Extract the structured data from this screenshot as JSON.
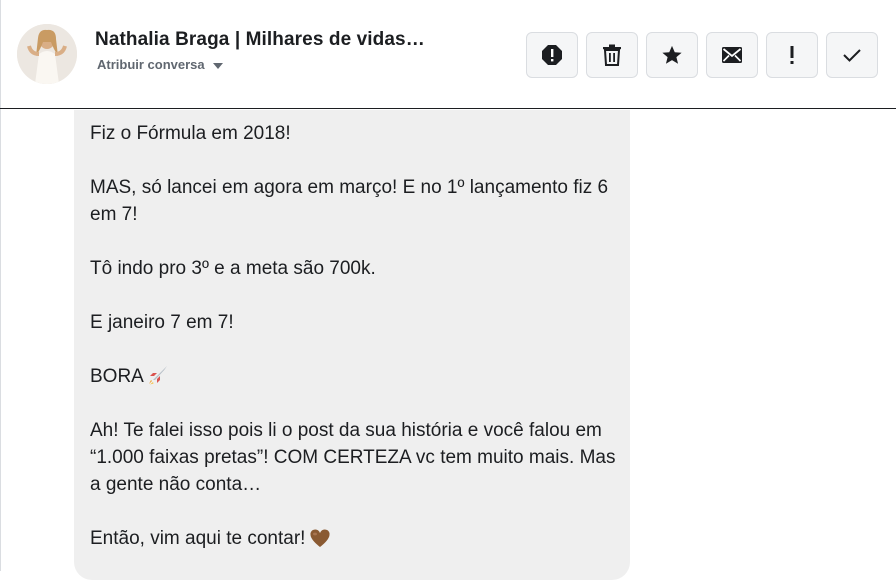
{
  "header": {
    "contact_name": "Nathalia Braga | Milhares de vidas…",
    "assign_label": "Atribuir conversa",
    "actions": [
      {
        "name": "report-button",
        "icon": "alert-circle-icon"
      },
      {
        "name": "delete-button",
        "icon": "trash-icon"
      },
      {
        "name": "star-button",
        "icon": "star-icon"
      },
      {
        "name": "mark-unread-button",
        "icon": "envelope-icon"
      },
      {
        "name": "priority-button",
        "icon": "exclamation-icon"
      },
      {
        "name": "done-button",
        "icon": "check-icon"
      }
    ]
  },
  "message": {
    "paragraphs": [
      "Fiz o Fórmula em 2018!",
      "MAS, só lancei em agora em março! E no 1º lançamento fiz 6 em 7!",
      "Tô indo pro 3º e a meta são 700k.",
      "E janeiro 7 em 7!",
      "BORA",
      "Ah! Te falei isso pois li o post da sua história e você falou em “1.000 faixas pretas”! COM CERTEZA vc tem muito mais. Mas a gente não conta…",
      "Então, vim aqui te contar!"
    ],
    "emojis": {
      "bora": "rocket-emoji",
      "final": "brown-heart-emoji"
    }
  },
  "colors": {
    "bubble": "#efefef",
    "button_bg": "#f5f6f7",
    "text": "#1c1e21",
    "subtext": "#606770"
  }
}
